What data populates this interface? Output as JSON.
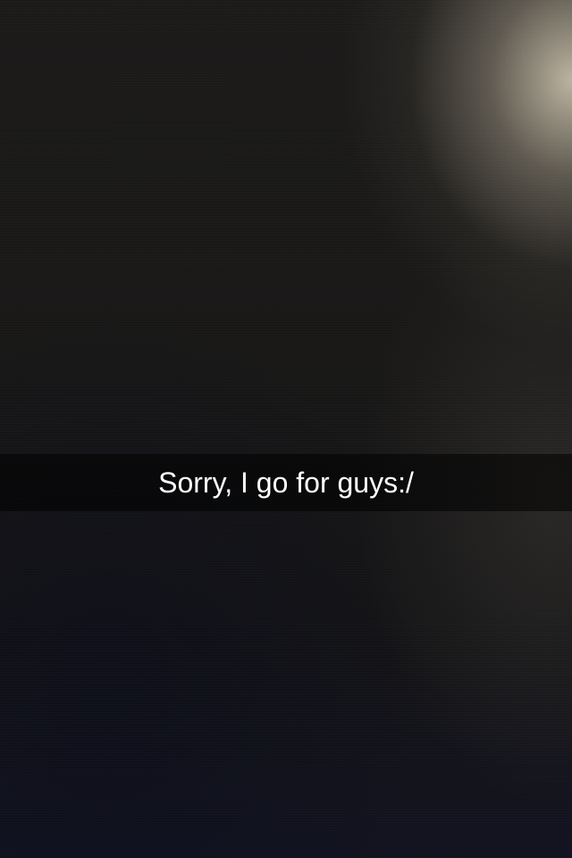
{
  "snap": {
    "caption": "Sorry, I go for guys:/"
  },
  "colors": {
    "caption_text": "#ffffff",
    "caption_bar": "rgba(0,0,0,0.55)",
    "background_dark": "#161616",
    "light_glow": "#ebe1c8"
  }
}
